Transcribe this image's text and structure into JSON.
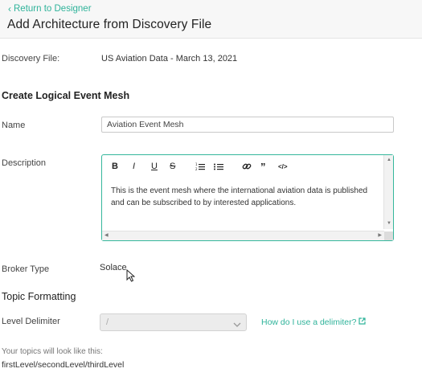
{
  "header": {
    "back_label": "Return to Designer",
    "title": "Add Architecture from Discovery File"
  },
  "discovery": {
    "label": "Discovery File:",
    "value": "US Aviation Data - March 13, 2021"
  },
  "section_create": "Create Logical Event Mesh",
  "name_field": {
    "label": "Name",
    "value": "Aviation Event Mesh"
  },
  "description_field": {
    "label": "Description",
    "toolbar": [
      "B",
      "I",
      "U",
      "S",
      "ordered-list",
      "bullet-list",
      "link",
      "quote",
      "code"
    ],
    "value": "This is the event mesh where the international aviation data is published and can be subscribed to by interested applications."
  },
  "broker": {
    "label": "Broker Type",
    "value": "Solace"
  },
  "section_topic": "Topic Formatting",
  "level_delimiter": {
    "label": "Level Delimiter",
    "value": "/",
    "help_link": "How do I use a delimiter?"
  },
  "preview": {
    "label": "Your topics will look like this:",
    "value": "firstLevel/secondLevel/thirdLevel"
  },
  "colors": {
    "accent": "#2fb39a",
    "focus_border": "#35b79c"
  }
}
